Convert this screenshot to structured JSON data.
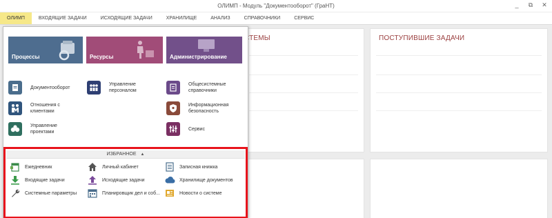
{
  "window": {
    "title": "ОЛИМП - Модуль \"Документооборот\" (ГраНТ)",
    "controls": [
      "_",
      "⧉",
      "✕"
    ]
  },
  "menubar": {
    "items": [
      {
        "label": "ОЛИМП",
        "active": true
      },
      {
        "label": "ВХОДЯЩИЕ ЗАДАЧИ"
      },
      {
        "label": "ИСХОДЯЩИЕ ЗАДАЧИ"
      },
      {
        "label": "ХРАНИЛИЩЕ"
      },
      {
        "label": "АНАЛИЗ"
      },
      {
        "label": "СПРАВОЧНИКИ"
      },
      {
        "label": "СЕРВИС"
      }
    ]
  },
  "panels": {
    "systems_title_fragment": "СТЕМЫ",
    "incoming_title": "ПОСТУПИВШИЕ ЗАДАЧИ"
  },
  "dropdown": {
    "tiles": [
      {
        "label": "Процессы",
        "color": "#4e6d8f"
      },
      {
        "label": "Ресурсы",
        "color": "#a14c78"
      },
      {
        "label": "Администрирование",
        "color": "#72508a"
      }
    ],
    "modules": [
      {
        "label": "Документооборот",
        "icon": "document-icon",
        "color": "#4a6d8c"
      },
      {
        "label": "Управление\nперсоналом",
        "icon": "people-icon",
        "color": "#2e3f73"
      },
      {
        "label": "Общесистемные\nсправочники",
        "icon": "directory-icon",
        "color": "#6b4a8a"
      },
      {
        "label": "Отношения с\nклиентами",
        "icon": "clients-icon",
        "color": "#30557d"
      },
      {
        "label": "Информационная\nбезопасность",
        "icon": "shield-icon",
        "color": "#8a4a3a"
      },
      {
        "label": "Управление\nпроектами",
        "icon": "projects-icon",
        "color": "#2f6f5f"
      },
      {
        "label": "Сервис",
        "icon": "service-icon",
        "color": "#7a2f62"
      }
    ],
    "favorites": {
      "header": "ИЗБРАННОЕ",
      "items": [
        {
          "label": "Ежедневник",
          "icon": "calendar-icon"
        },
        {
          "label": "Личный кабинет",
          "icon": "home-icon"
        },
        {
          "label": "Записная книжка",
          "icon": "notebook-icon"
        },
        {
          "label": "Входящие задачи",
          "icon": "download-icon"
        },
        {
          "label": "Исходящие задачи",
          "icon": "upload-icon"
        },
        {
          "label": "Хранилище документов",
          "icon": "cloud-icon"
        },
        {
          "label": "Системные параметры",
          "icon": "wrench-icon"
        },
        {
          "label": "Планировщик дел и соб...",
          "icon": "planner-icon"
        },
        {
          "label": "Новости о системе",
          "icon": "news-icon"
        }
      ]
    }
  }
}
